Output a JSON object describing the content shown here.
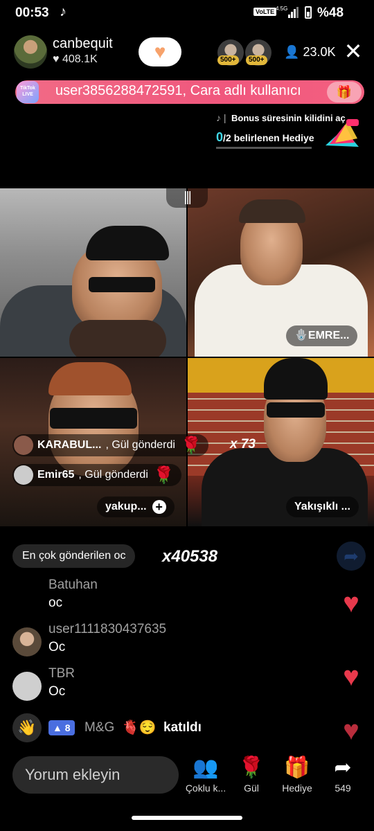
{
  "status": {
    "time": "00:53",
    "volte": "VoLTE",
    "net": "4.5G",
    "battery": "%48"
  },
  "host": {
    "name": "canbequit",
    "likes": "408.1K"
  },
  "top_viewers": [
    {
      "badge": "500+"
    },
    {
      "badge": "500+"
    }
  ],
  "viewer_count": "23.0K",
  "banner": {
    "text": "user3856288472591, Cara adlı kullanıcı",
    "badge": "TikTok LIVE"
  },
  "unlock": {
    "title": "Bonus süresinin kilidini aç",
    "progress_current": "0",
    "progress_total": "/2",
    "progress_label": "belirlenen Hediye",
    "progress": 0
  },
  "tiles": {
    "t2_name": "EMRE...",
    "t3_name": "yakup...",
    "t4_name": "Yakışıklı ..."
  },
  "gifts": [
    {
      "user": "KARABUL...",
      "action": ", Gül gönderdi",
      "count": "x 73"
    },
    {
      "user": "Emir65",
      "action": ", Gül gönderdi"
    }
  ],
  "top_gift": {
    "label": "En çok gönderilen",
    "code": "oc",
    "count": "x40538"
  },
  "chat": [
    {
      "user": "Batuhan",
      "text": "oc"
    },
    {
      "user": "user1111830437635",
      "text": "Oc"
    },
    {
      "user": "TBR",
      "text": "Oc"
    }
  ],
  "joined": {
    "level": "8",
    "user": "M&G",
    "text": "katıldı"
  },
  "bottom": {
    "comment_placeholder": "Yorum ekleyin",
    "multi_label": "Çoklu k...",
    "rose_label": "Gül",
    "gift_label": "Hediye",
    "share_count": "549"
  },
  "colors": {
    "accent_pink": "#f0577d",
    "heart": "#e8394c",
    "progress": "#42d9e8"
  }
}
